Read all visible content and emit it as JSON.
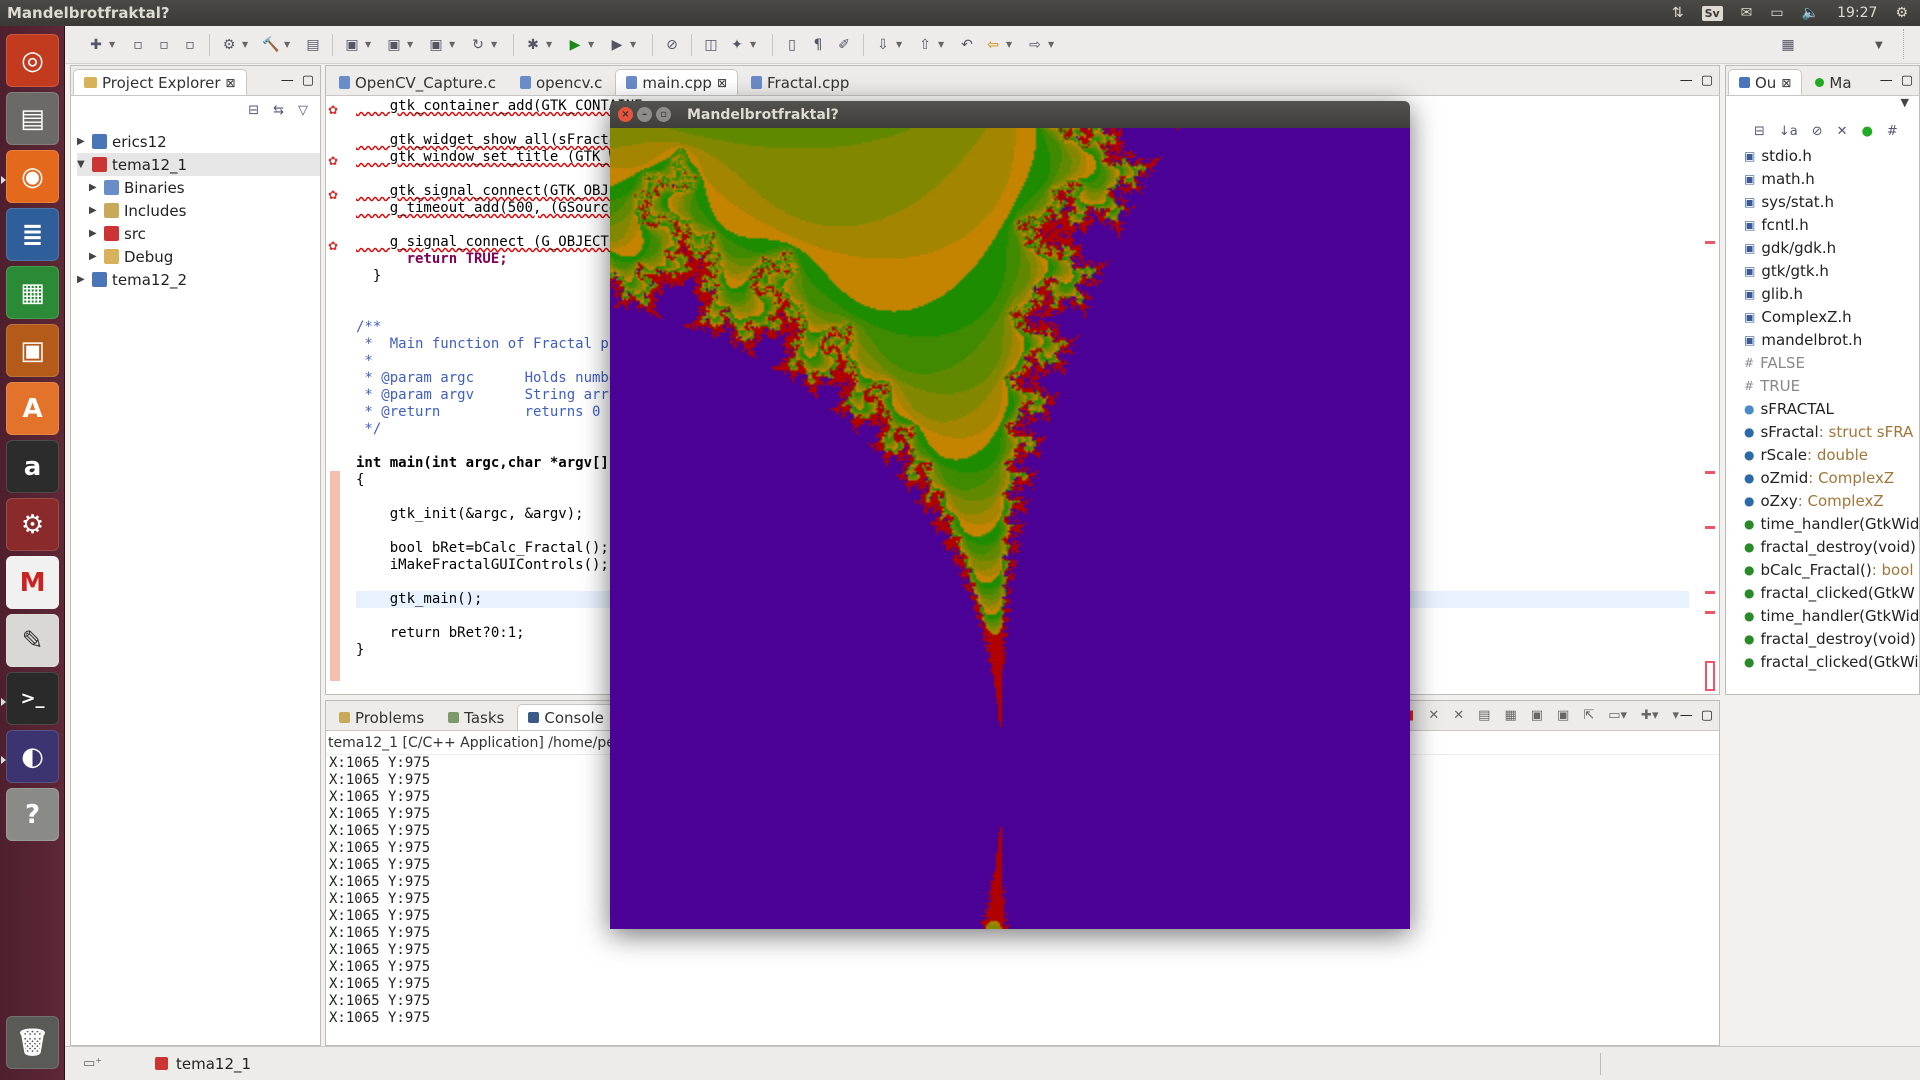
{
  "topbar": {
    "title": "Mandelbrotfraktal?",
    "time": "19:27",
    "keyboard": "Sv"
  },
  "launcher": [
    "dash",
    "files",
    "firefox",
    "libreoffice-writer",
    "libreoffice-calc",
    "libreoffice-impress",
    "software-center",
    "amazon",
    "system-settings",
    "gmail",
    "text-editor",
    "terminal",
    "eclipse",
    "help",
    "trash"
  ],
  "project_explorer": {
    "tab": "Project Explorer",
    "items": [
      {
        "label": "erics12",
        "level": 0,
        "expanded": false
      },
      {
        "label": "tema12_1",
        "level": 0,
        "expanded": true,
        "selected": true
      },
      {
        "label": "Binaries",
        "level": 1
      },
      {
        "label": "Includes",
        "level": 1
      },
      {
        "label": "src",
        "level": 1
      },
      {
        "label": "Debug",
        "level": 1
      },
      {
        "label": "tema12_2",
        "level": 0,
        "expanded": false
      }
    ]
  },
  "editor": {
    "tabs": [
      "OpenCV_Capture.c",
      "opencv.c",
      "main.cpp",
      "Fractal.cpp"
    ],
    "active_tab": "main.cpp",
    "lines": [
      "    gtk_container_add(GTK_CONTAINE",
      "",
      "    gtk_widget_show_all(sFractal.p",
      "    gtk_window_set_title (GTK_WIND",
      "",
      "    gtk_signal_connect(GTK_OBJECT",
      "    g_timeout_add(500, (GSourceFu",
      "",
      "    g_signal_connect (G_OBJECT (p",
      "      return TRUE;",
      "  }",
      "",
      "",
      "/**",
      " *  Main function of Fractal pr",
      " *",
      " * @param argc      Holds numbe",
      " * @param argv      String arra",
      " * @return          returns 0 i",
      " */",
      "",
      "int main(int argc,char *argv[])",
      "{",
      "",
      "    gtk_init(&argc, &argv);",
      "",
      "    bool bRet=bCalc_Fractal();",
      "    iMakeFractalGUIControls();",
      "",
      "    gtk_main();",
      "",
      "    return bRet?0:1;",
      "}"
    ]
  },
  "console": {
    "tabs": [
      "Problems",
      "Tasks",
      "Console"
    ],
    "active_tab": "Console",
    "header": "tema12_1 [C/C++ Application] /home/pette",
    "lines": [
      "X:1065 Y:975",
      "X:1065 Y:975",
      "X:1065 Y:975",
      "X:1065 Y:975",
      "X:1065 Y:975",
      "X:1065 Y:975",
      "X:1065 Y:975",
      "X:1065 Y:975",
      "X:1065 Y:975",
      "X:1065 Y:975",
      "X:1065 Y:975",
      "X:1065 Y:975",
      "X:1065 Y:975",
      "X:1065 Y:975",
      "X:1065 Y:975",
      "X:1065 Y:975"
    ]
  },
  "outline": {
    "tabs": [
      "Ou",
      "Ma"
    ],
    "items": [
      {
        "label": "stdio.h",
        "type": "include"
      },
      {
        "label": "math.h",
        "type": "include"
      },
      {
        "label": "sys/stat.h",
        "type": "include"
      },
      {
        "label": "fcntl.h",
        "type": "include"
      },
      {
        "label": "gdk/gdk.h",
        "type": "include"
      },
      {
        "label": "gtk/gtk.h",
        "type": "include"
      },
      {
        "label": "glib.h",
        "type": "include"
      },
      {
        "label": "ComplexZ.h",
        "type": "include"
      },
      {
        "label": "mandelbrot.h",
        "type": "include"
      },
      {
        "label": "FALSE",
        "type": "macro"
      },
      {
        "label": "TRUE",
        "type": "macro"
      },
      {
        "label": "sFRACTAL",
        "type": "struct"
      },
      {
        "label": "sFractal",
        "suffix": " : struct sFRA",
        "type": "var"
      },
      {
        "label": "rScale",
        "suffix": " : double",
        "type": "var"
      },
      {
        "label": "oZmid",
        "suffix": " : ComplexZ",
        "type": "var"
      },
      {
        "label": "oZxy",
        "suffix": " : ComplexZ",
        "type": "var"
      },
      {
        "label": "time_handler(GtkWid",
        "type": "func"
      },
      {
        "label": "fractal_destroy(void)",
        "type": "func"
      },
      {
        "label": "bCalc_Fractal()",
        "suffix": " : bool",
        "type": "func"
      },
      {
        "label": "fractal_clicked(GtkW",
        "type": "func"
      },
      {
        "label": "time_handler(GtkWid",
        "type": "func"
      },
      {
        "label": "fractal_destroy(void)",
        "type": "func"
      },
      {
        "label": "fractal_clicked(GtkWi",
        "type": "func"
      }
    ]
  },
  "status": {
    "project": "tema12_1"
  },
  "fractal_window": {
    "title": "Mandelbrotfraktal?"
  },
  "colors": {
    "mandel_inside": "#4b0096",
    "mandel_border": "#b00000",
    "green": "#1e8c00",
    "orange": "#e08a00"
  }
}
